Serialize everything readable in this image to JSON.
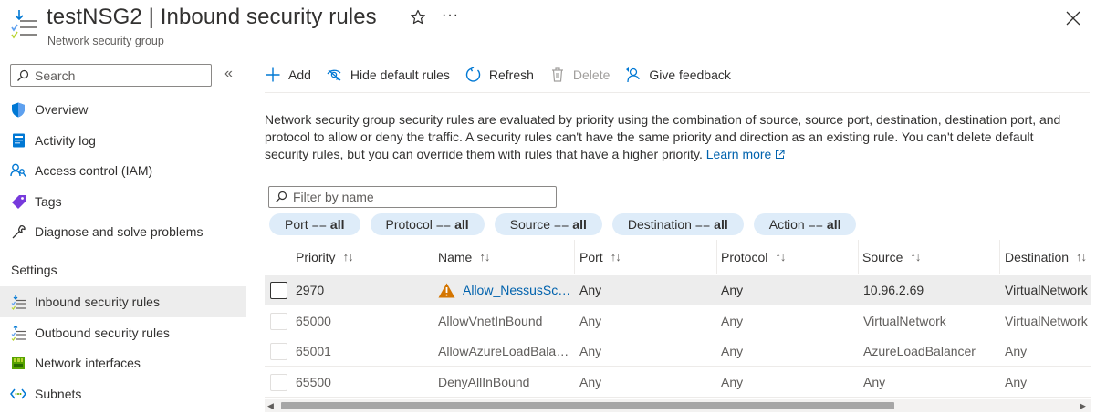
{
  "header": {
    "resource_name": "testNSG2",
    "separator": "|",
    "page_title": "Inbound security rules",
    "subtitle": "Network security group",
    "more_label": "···"
  },
  "sidebar": {
    "search_placeholder": "Search",
    "collapse_label": "«",
    "items": [
      {
        "label": "Overview",
        "icon": "shield-icon"
      },
      {
        "label": "Activity log",
        "icon": "activity-log-icon"
      },
      {
        "label": "Access control (IAM)",
        "icon": "iam-users-icon"
      },
      {
        "label": "Tags",
        "icon": "tag-icon"
      },
      {
        "label": "Diagnose and solve problems",
        "icon": "wrench-icon"
      }
    ],
    "settings_heading": "Settings",
    "settings_items": [
      {
        "label": "Inbound security rules",
        "icon": "inbound-rules-icon",
        "active": true
      },
      {
        "label": "Outbound security rules",
        "icon": "outbound-rules-icon",
        "active": false
      },
      {
        "label": "Network interfaces",
        "icon": "network-interface-icon",
        "active": false
      },
      {
        "label": "Subnets",
        "icon": "subnet-icon",
        "active": false
      }
    ]
  },
  "toolbar": {
    "add": "Add",
    "hide_default": "Hide default rules",
    "refresh": "Refresh",
    "delete": "Delete",
    "feedback": "Give feedback"
  },
  "description": {
    "text": "Network security group security rules are evaluated by priority using the combination of source, source port, destination, destination port, and protocol to allow or deny the traffic. A security rules can't have the same priority and direction as an existing rule. You can't delete default security rules, but you can override them with rules that have a higher priority.",
    "learn_more": "Learn more"
  },
  "filter": {
    "placeholder": "Filter by name",
    "pills": [
      {
        "label": "Port ==",
        "value": "all"
      },
      {
        "label": "Protocol ==",
        "value": "all"
      },
      {
        "label": "Source ==",
        "value": "all"
      },
      {
        "label": "Destination ==",
        "value": "all"
      },
      {
        "label": "Action ==",
        "value": "all"
      }
    ]
  },
  "table": {
    "columns": {
      "priority": "Priority",
      "name": "Name",
      "port": "Port",
      "protocol": "Protocol",
      "source": "Source",
      "destination": "Destination"
    },
    "sort_glyph": "↑↓",
    "rows": [
      {
        "priority": "2970",
        "name": "Allow_NessusScan…",
        "port": "Any",
        "protocol": "Any",
        "source": "10.96.2.69",
        "destination": "VirtualNetwork",
        "warning": true,
        "link": true
      },
      {
        "priority": "65000",
        "name": "AllowVnetInBound",
        "port": "Any",
        "protocol": "Any",
        "source": "VirtualNetwork",
        "destination": "VirtualNetwork",
        "warning": false,
        "link": false
      },
      {
        "priority": "65001",
        "name": "AllowAzureLoadBalan…",
        "port": "Any",
        "protocol": "Any",
        "source": "AzureLoadBalancer",
        "destination": "Any",
        "warning": false,
        "link": false
      },
      {
        "priority": "65500",
        "name": "DenyAllInBound",
        "port": "Any",
        "protocol": "Any",
        "source": "Any",
        "destination": "Any",
        "warning": false,
        "link": false
      }
    ]
  },
  "colors": {
    "link": "#0062ad",
    "accent": "#0078d4",
    "pill_bg": "#deecf9",
    "warning": "#d47500",
    "selected_row": "#ededed"
  }
}
